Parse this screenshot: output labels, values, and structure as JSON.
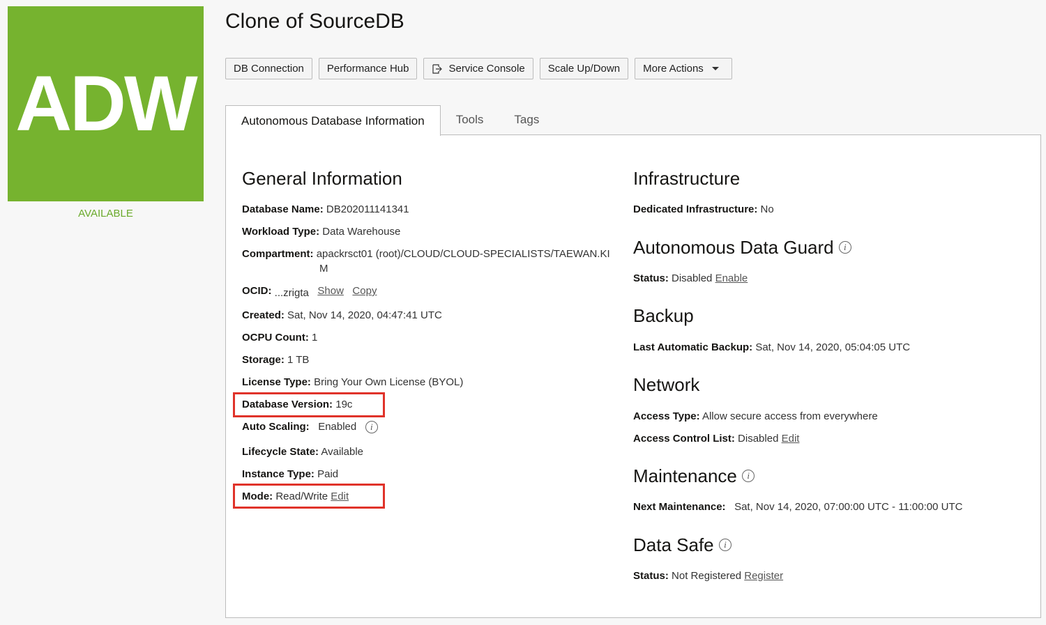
{
  "logo": {
    "text": "ADW",
    "state": "AVAILABLE"
  },
  "title": "Clone of SourceDB",
  "toolbar": {
    "db_connection": "DB Connection",
    "performance_hub": "Performance Hub",
    "service_console": "Service Console",
    "scale": "Scale Up/Down",
    "more_actions": "More Actions"
  },
  "tabs": [
    "Autonomous Database Information",
    "Tools",
    "Tags"
  ],
  "general": {
    "heading": "General Information",
    "database_name_label": "Database Name:",
    "database_name": "DB202011141341",
    "workload_label": "Workload Type:",
    "workload": "Data Warehouse",
    "compartment_label": "Compartment:",
    "compartment_line1": "apackrsct01 (root)/CLOUD/CLOUD-SPECIALISTS/TAEWAN.KI",
    "compartment_line2": "M",
    "ocid_label": "OCID:",
    "ocid": "...zrigta",
    "ocid_show": "Show",
    "ocid_copy": "Copy",
    "created_label": "Created:",
    "created": "Sat, Nov 14, 2020, 04:47:41 UTC",
    "ocpu_label": "OCPU Count:",
    "ocpu": "1",
    "storage_label": "Storage:",
    "storage": "1 TB",
    "license_label": "License Type:",
    "license": "Bring Your Own License (BYOL)",
    "version_label": "Database Version:",
    "version": "19c",
    "autoscaling_label": "Auto Scaling:",
    "autoscaling": "Enabled",
    "lifecycle_label": "Lifecycle State:",
    "lifecycle": "Available",
    "instance_label": "Instance Type:",
    "instance": "Paid",
    "mode_label": "Mode:",
    "mode": "Read/Write",
    "mode_edit": "Edit"
  },
  "infrastructure": {
    "heading": "Infrastructure",
    "dedicated_label": "Dedicated Infrastructure:",
    "dedicated": "No"
  },
  "data_guard": {
    "heading": "Autonomous Data Guard",
    "status_label": "Status:",
    "status": "Disabled",
    "action": "Enable"
  },
  "backup": {
    "heading": "Backup",
    "last_label": "Last Automatic Backup:",
    "last": "Sat, Nov 14, 2020, 05:04:05 UTC"
  },
  "network": {
    "heading": "Network",
    "access_label": "Access Type:",
    "access": "Allow secure access from everywhere",
    "acl_label": "Access Control List:",
    "acl": "Disabled",
    "acl_edit": "Edit"
  },
  "maintenance": {
    "heading": "Maintenance",
    "next_label": "Next Maintenance:",
    "next": "Sat, Nov 14, 2020, 07:00:00 UTC - 11:00:00 UTC"
  },
  "data_safe": {
    "heading": "Data Safe",
    "status_label": "Status:",
    "status": "Not Registered",
    "action": "Register"
  },
  "info_glyph": "i",
  "colors": {
    "logo_bg": "#76b32f",
    "available": "#6aaa2b",
    "highlight": "#e0332a"
  }
}
